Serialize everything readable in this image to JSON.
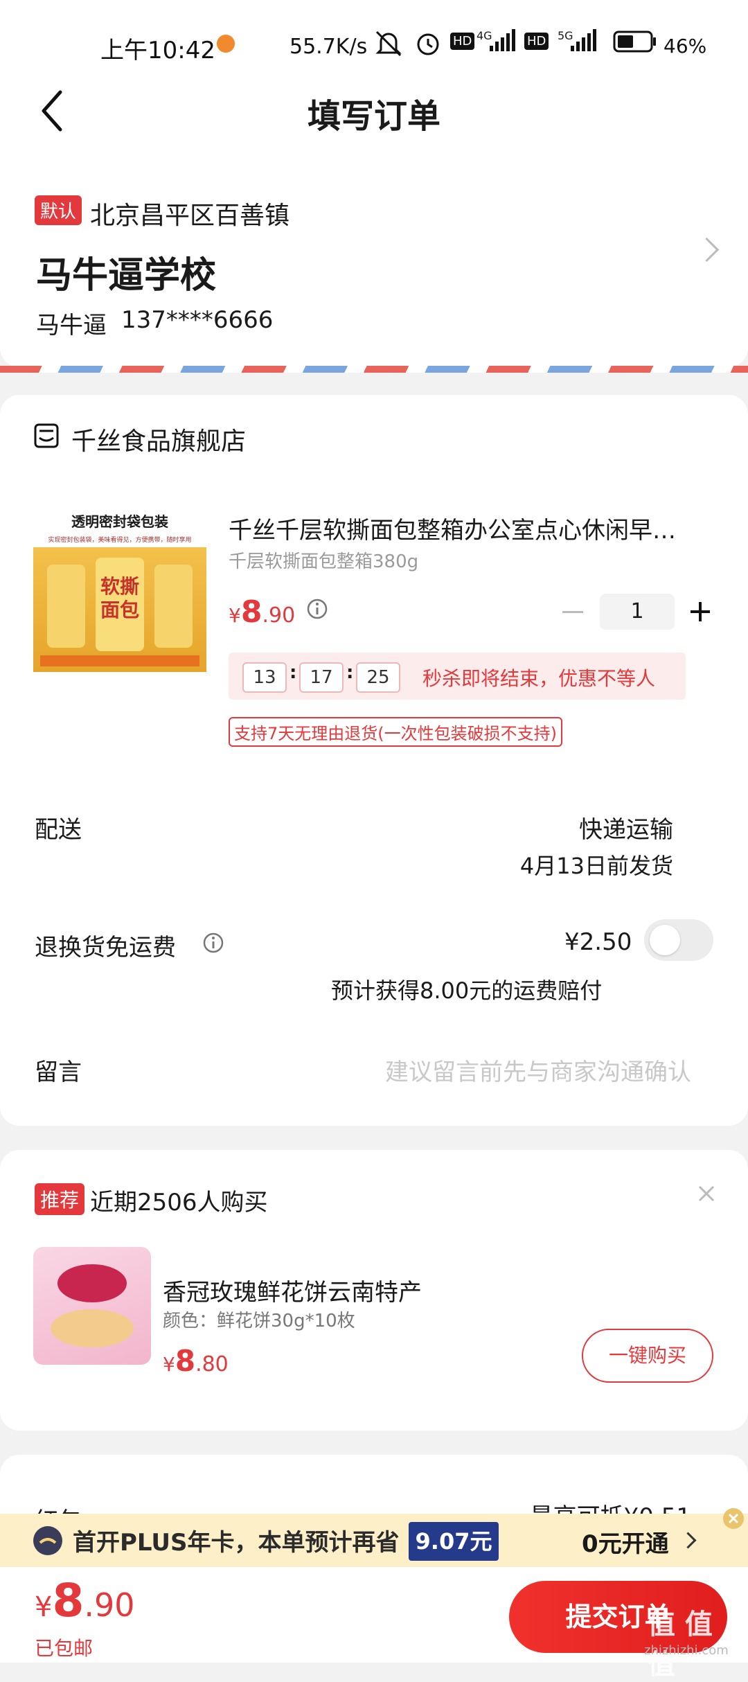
{
  "status_bar": {
    "time": "上午10:42",
    "net_speed": "55.7K/s",
    "battery": "46%",
    "net1": "4G",
    "net2": "5G"
  },
  "header": {
    "title": "填写订单"
  },
  "address": {
    "default_badge": "默认",
    "region": "北京昌平区百善镇",
    "detail": "马牛逼学校",
    "name": "马牛逼",
    "phone": "137****6666"
  },
  "store": {
    "name": "千丝食品旗舰店",
    "product": {
      "image_caption": "透明密封袋包装",
      "image_sub": "实现密封包装袋，美味看得见，方便携带，随时享用",
      "image_text": "软撕面包",
      "title": "千丝千层软撕面包整箱办公室点心休闲早…",
      "spec": "千层软撕面包整箱380g",
      "price_symbol": "¥",
      "price_int": "8",
      "price_dec": ".90",
      "quantity": "1",
      "timer_h": "13",
      "timer_m": "17",
      "timer_s": "25",
      "timer_text": "秒杀即将结束，优惠不等人",
      "return_note": "支持7天无理由退货(一次性包装破损不支持)"
    }
  },
  "delivery": {
    "label": "配送",
    "method": "快递运输",
    "ship_by": "4月13日前发货"
  },
  "return_fee": {
    "label": "退换货免运费",
    "price": "¥2.50",
    "note": "预计获得8.00元的运费赔付"
  },
  "message": {
    "label": "留言",
    "placeholder": "建议留言前先与商家沟通确认"
  },
  "recommend": {
    "badge": "推荐",
    "title": "近期2506人购买",
    "product_title": "香冠玫瑰鲜花饼云南特产",
    "product_spec": "颜色：鲜花饼30g*10枚",
    "price_symbol": "¥",
    "price_int": "8",
    "price_dec": ".80",
    "button": "一键购买"
  },
  "coupon": {
    "label": "红包",
    "value": "最高可抵¥0.51"
  },
  "plus_banner": {
    "text": "首开PLUS年卡，本单预计再省",
    "amount": "9.07元",
    "cta": "0元开通"
  },
  "footer": {
    "price_symbol": "¥",
    "price_int": "8",
    "price_dec": ".90",
    "shipping": "已包邮",
    "submit": "提交订单",
    "watermark": "值 值 值",
    "watermark_url": "zhizhizhi.com"
  },
  "colors": {
    "accent": "#e4393c",
    "submit_gradient_start": "#f0312c",
    "plus_bg": "#fdf0c8"
  }
}
